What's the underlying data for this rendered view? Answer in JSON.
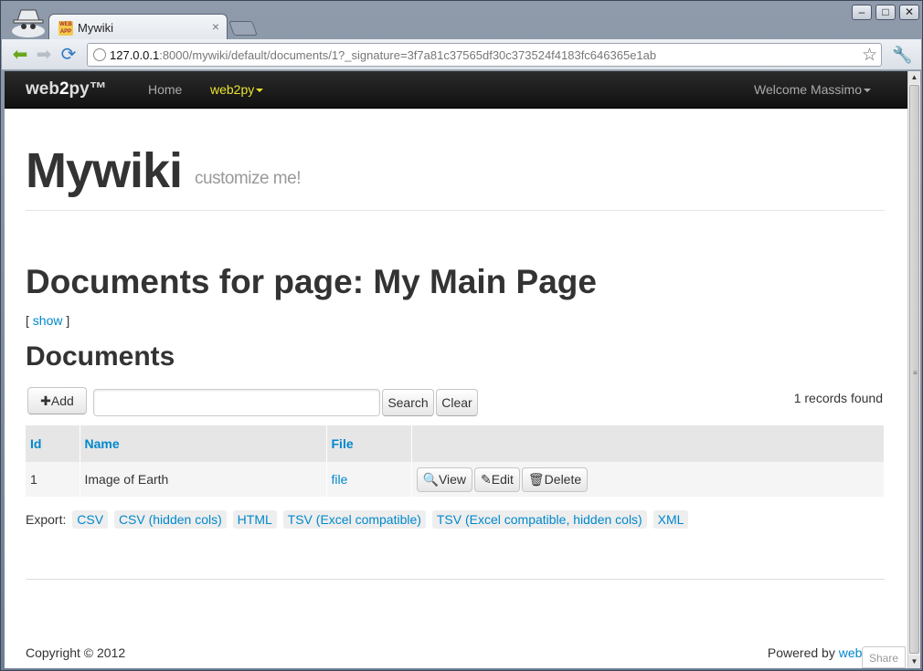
{
  "browser": {
    "tab_title": "Mywiki",
    "tab_favicon_text": "WEB APP",
    "url_host": "127.0.0.1",
    "url_rest": ":8000/mywiki/default/documents/1?_signature=3f7a81c37565df30c373524f4183fc646365e1ab",
    "win_min": "‒",
    "win_max": "□",
    "win_close": "✕"
  },
  "navbar": {
    "brand_pre": "web",
    "brand_bold": "2",
    "brand_post": "py™",
    "home": "Home",
    "web2py_menu": "web2py",
    "welcome": "Welcome Massimo"
  },
  "header": {
    "title": "Mywiki",
    "subtitle": "customize me!"
  },
  "content": {
    "page_heading": "Documents for page: My Main Page",
    "show_open": "[ ",
    "show_link": "show",
    "show_close": " ]",
    "docs_heading": "Documents",
    "add_button": "Add",
    "search_value": "",
    "search_button": "Search",
    "clear_button": "Clear",
    "records_found": "1 records found"
  },
  "table": {
    "headers": [
      "Id",
      "Name",
      "File",
      ""
    ],
    "rows": [
      {
        "id": "1",
        "name": "Image of Earth",
        "file": "file",
        "view": "View",
        "edit": "Edit",
        "delete": "Delete"
      }
    ]
  },
  "export": {
    "label": "Export:",
    "options": [
      "CSV",
      "CSV (hidden cols)",
      "HTML",
      "TSV (Excel compatible)",
      "TSV (Excel compatible, hidden cols)",
      "XML"
    ]
  },
  "footer": {
    "copyright": "Copyright © 2012",
    "powered_by": "Powered by ",
    "powered_link": "web2py",
    "share": "Share"
  }
}
